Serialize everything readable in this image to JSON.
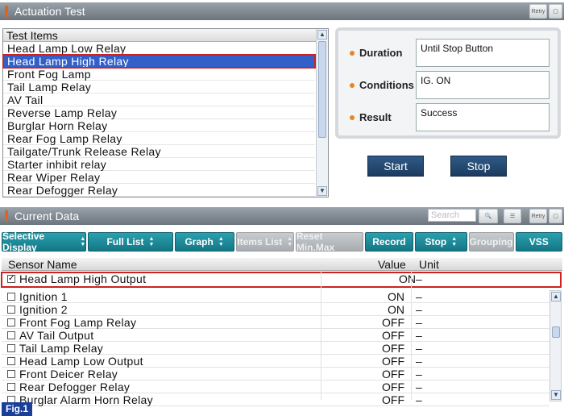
{
  "actuation": {
    "title": "Actuation Test",
    "retry_icon": "retry-icon",
    "list_header": "Test Items",
    "items": [
      "Head Lamp Low Relay",
      "Head Lamp High Relay",
      "Front Fog Lamp",
      "Tail Lamp Relay",
      "AV Tail",
      "Reverse Lamp Relay",
      "Burglar Horn Relay",
      "Rear Fog Lamp Relay",
      "Tailgate/Trunk Release Relay",
      "Starter inhibit relay",
      "Rear Wiper Relay",
      "Rear Defogger Relay"
    ],
    "selected_index": 1,
    "duration_label": "Duration",
    "duration_value": "Until Stop Button",
    "conditions_label": "Conditions",
    "conditions_value": "IG. ON",
    "result_label": "Result",
    "result_value": "Success",
    "start_label": "Start",
    "stop_label": "Stop"
  },
  "current": {
    "title": "Current Data",
    "search_placeholder": "Search",
    "buttons": [
      {
        "label": "Selective Display",
        "enabled": true,
        "updown": true
      },
      {
        "label": "Full List",
        "enabled": true,
        "updown": true
      },
      {
        "label": "Graph",
        "enabled": true,
        "updown": true
      },
      {
        "label": "Items List",
        "enabled": false,
        "updown": true
      },
      {
        "label": "Reset Min.Max",
        "enabled": false,
        "updown": false
      },
      {
        "label": "Record",
        "enabled": true,
        "updown": false
      },
      {
        "label": "Stop",
        "enabled": true,
        "updown": true
      },
      {
        "label": "Grouping",
        "enabled": false,
        "updown": false
      },
      {
        "label": "VSS",
        "enabled": true,
        "updown": false
      }
    ],
    "col_name": "Sensor Name",
    "col_value": "Value",
    "col_unit": "Unit",
    "rows": [
      {
        "name": "Head Lamp High Output",
        "value": "ON",
        "unit": "–",
        "checked": true
      },
      {
        "name": "Ignition 1",
        "value": "ON",
        "unit": "–",
        "checked": false
      },
      {
        "name": "Ignition 2",
        "value": "ON",
        "unit": "–",
        "checked": false
      },
      {
        "name": "Front Fog Lamp Relay",
        "value": "OFF",
        "unit": "–",
        "checked": false
      },
      {
        "name": "AV Tail Output",
        "value": "OFF",
        "unit": "–",
        "checked": false
      },
      {
        "name": "Tail Lamp Relay",
        "value": "OFF",
        "unit": "–",
        "checked": false
      },
      {
        "name": "Head Lamp Low Output",
        "value": "OFF",
        "unit": "–",
        "checked": false
      },
      {
        "name": "Front Deicer Relay",
        "value": "OFF",
        "unit": "–",
        "checked": false
      },
      {
        "name": "Rear Defogger Relay",
        "value": "OFF",
        "unit": "–",
        "checked": false
      },
      {
        "name": "Burglar Alarm Horn Relay",
        "value": "OFF",
        "unit": "–",
        "checked": false
      }
    ]
  },
  "figure_label": "Fig.1"
}
